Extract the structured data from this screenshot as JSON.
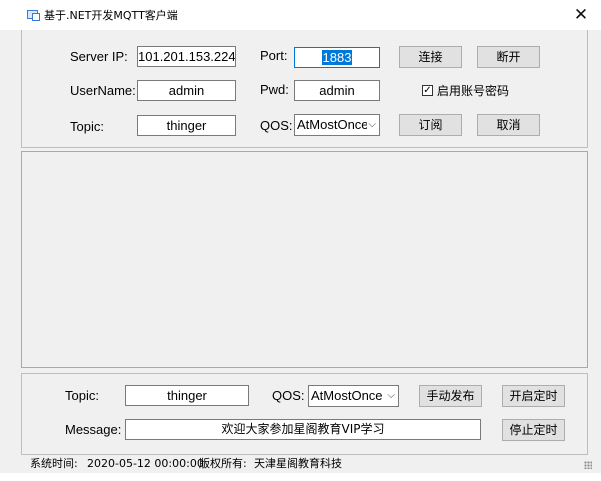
{
  "window": {
    "title": "基于.NET开发MQTT客户端",
    "close_glyph": "✕"
  },
  "connection": {
    "server_ip_label": "Server IP:",
    "server_ip_value": "101.201.153.224",
    "port_label": "Port:",
    "port_value": "1883",
    "connect_label": "连接",
    "disconnect_label": "断开",
    "username_label": "UserName:",
    "username_value": "admin",
    "pwd_label": "Pwd:",
    "pwd_value": "admin",
    "enable_account_label": "启用账号密码",
    "enable_account_checked": true,
    "topic_label": "Topic:",
    "topic_value": "thinger",
    "qos_label": "QOS:",
    "qos_value": "AtMostOnce",
    "subscribe_label": "订阅",
    "cancel_label": "取消"
  },
  "log": {
    "content": ""
  },
  "publish": {
    "topic_label": "Topic:",
    "topic_value": "thinger",
    "qos_label": "QOS:",
    "qos_value": "AtMostOnce",
    "manual_publish_label": "手动发布",
    "start_timer_label": "开启定时",
    "message_label": "Message:",
    "message_value": "欢迎大家参加星阁教育VIP学习",
    "stop_timer_label": "停止定时"
  },
  "status": {
    "time_label": "系统时间:",
    "time_value": "2020-05-12 00:00:00",
    "copyright_label": "版权所有:",
    "copyright_value": "天津星阁教育科技"
  },
  "colors": {
    "accent": "#0078d7",
    "window_bg": "#f0f0f0",
    "button_bg": "#e1e1e1"
  }
}
